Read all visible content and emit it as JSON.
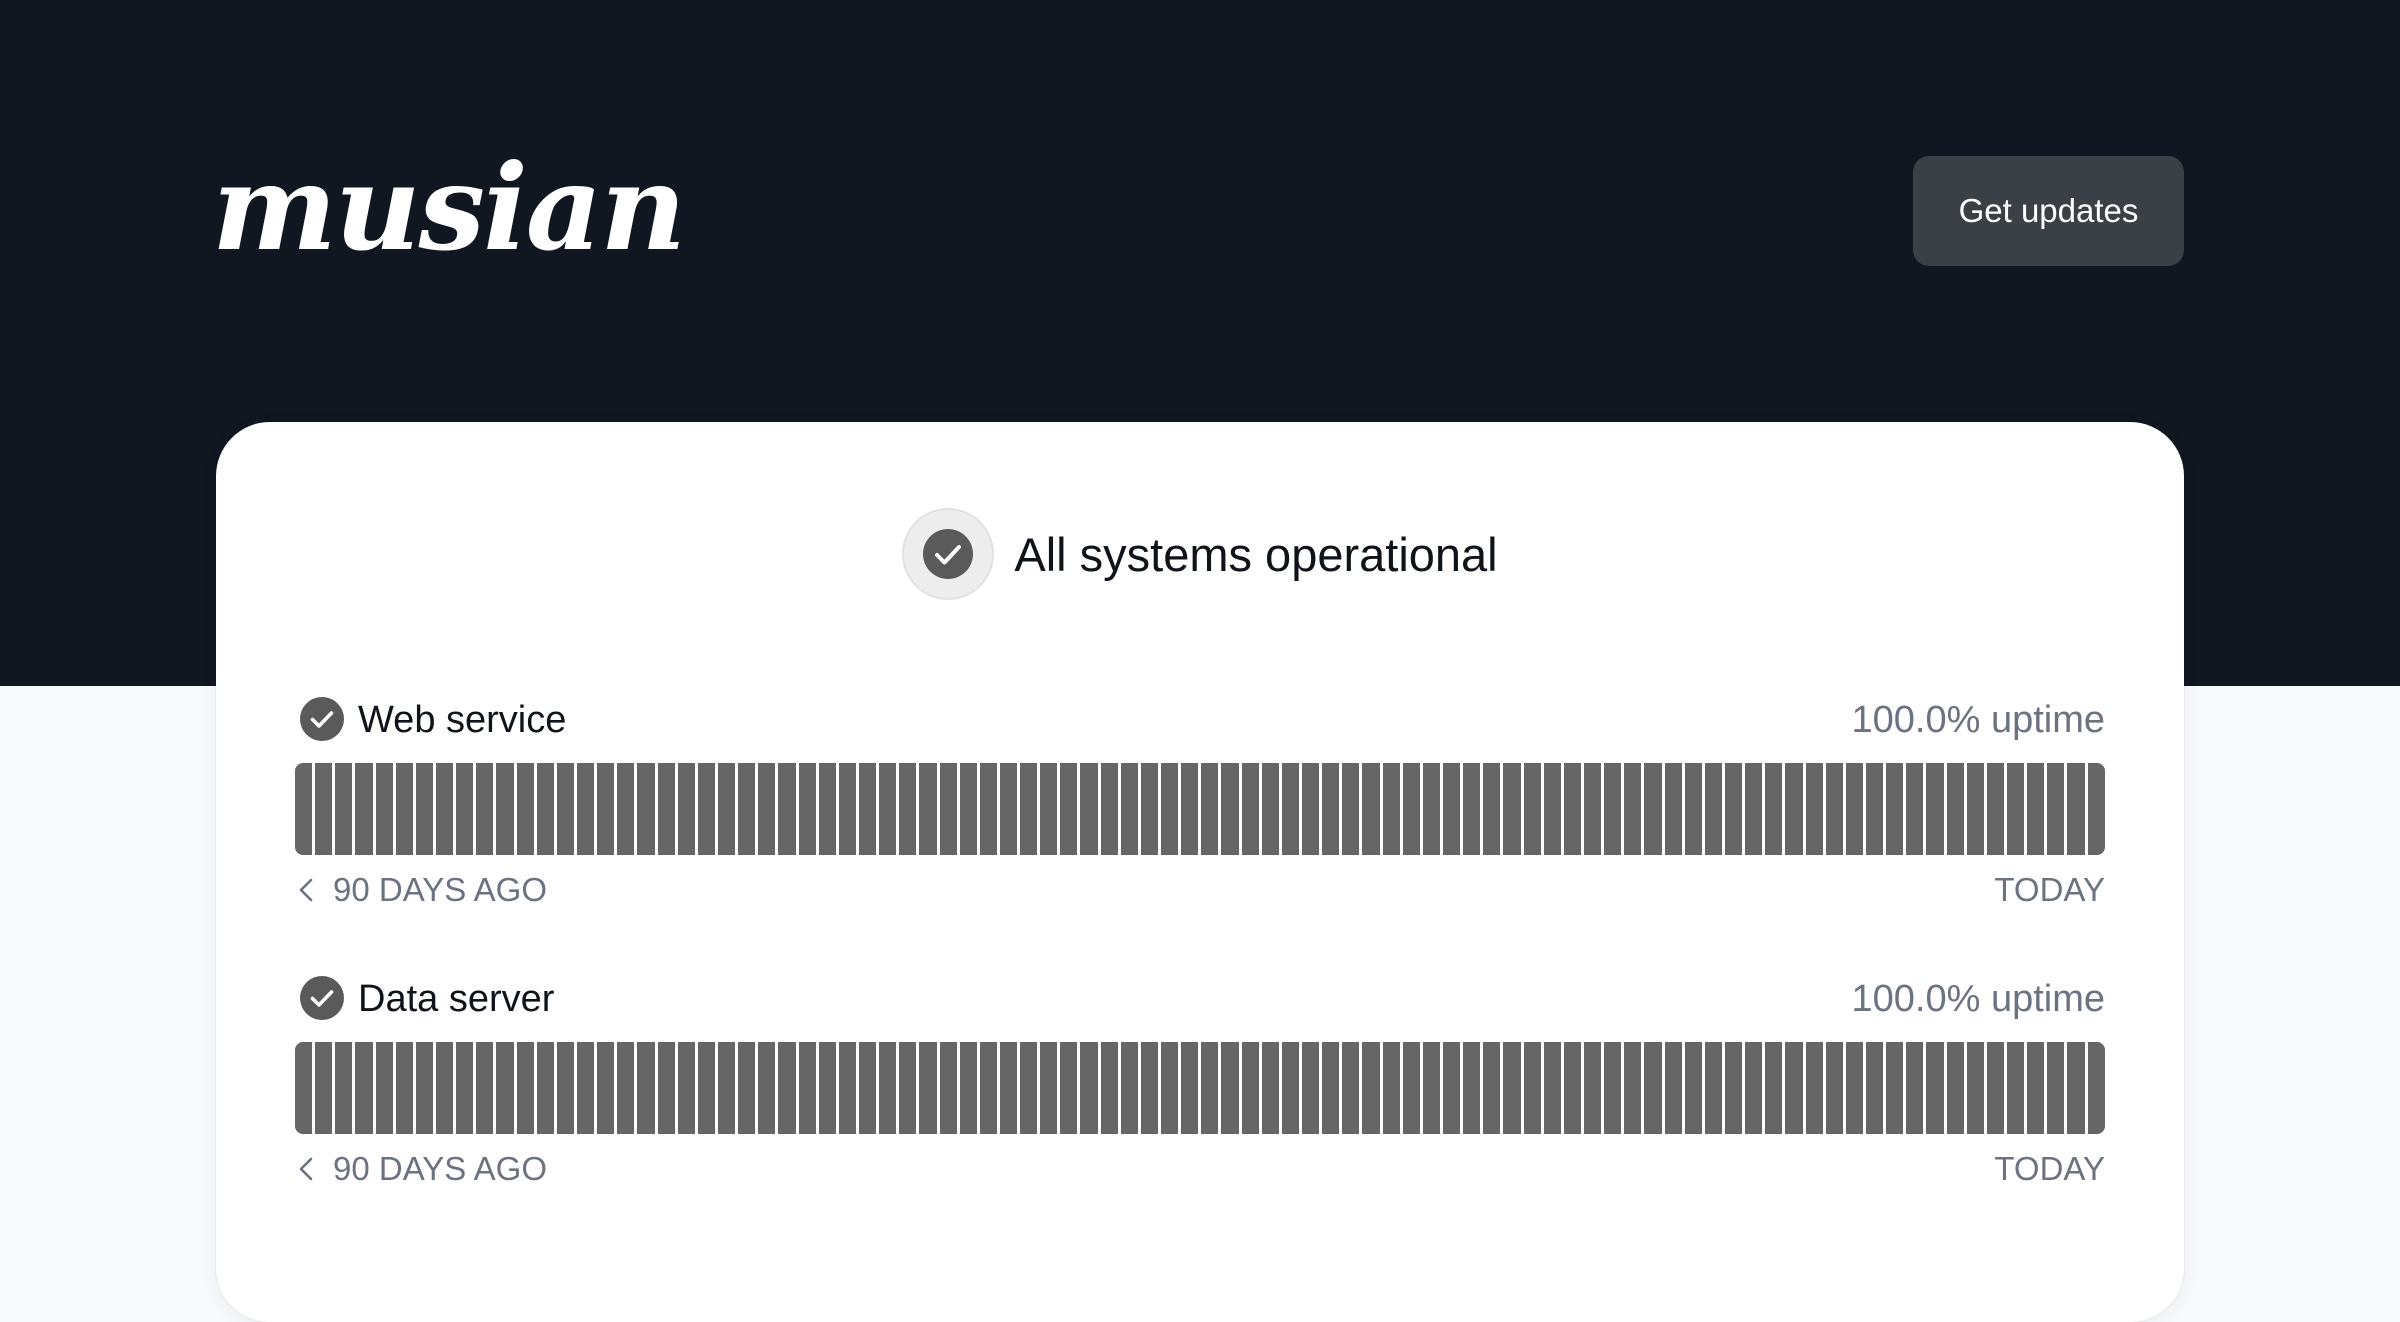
{
  "brand": {
    "logo_text": "musian"
  },
  "header": {
    "updates_button_label": "Get updates"
  },
  "overall_status": {
    "label": "All systems operational",
    "icon": "check-circle-icon"
  },
  "colors": {
    "header_bg": "#111720",
    "page_bg": "#f8f9fb",
    "status_bar_fill": "#666666",
    "button_bg": "#3b3f46",
    "muted_text": "#6b7280"
  },
  "components": [
    {
      "name": "Web service",
      "uptime": "100.0% uptime",
      "status": "operational",
      "days_shown": 90,
      "range_start_label": "90 DAYS AGO",
      "range_end_label": "TODAY"
    },
    {
      "name": "Data server",
      "uptime": "100.0% uptime",
      "status": "operational",
      "days_shown": 90,
      "range_start_label": "90 DAYS AGO",
      "range_end_label": "TODAY"
    }
  ]
}
